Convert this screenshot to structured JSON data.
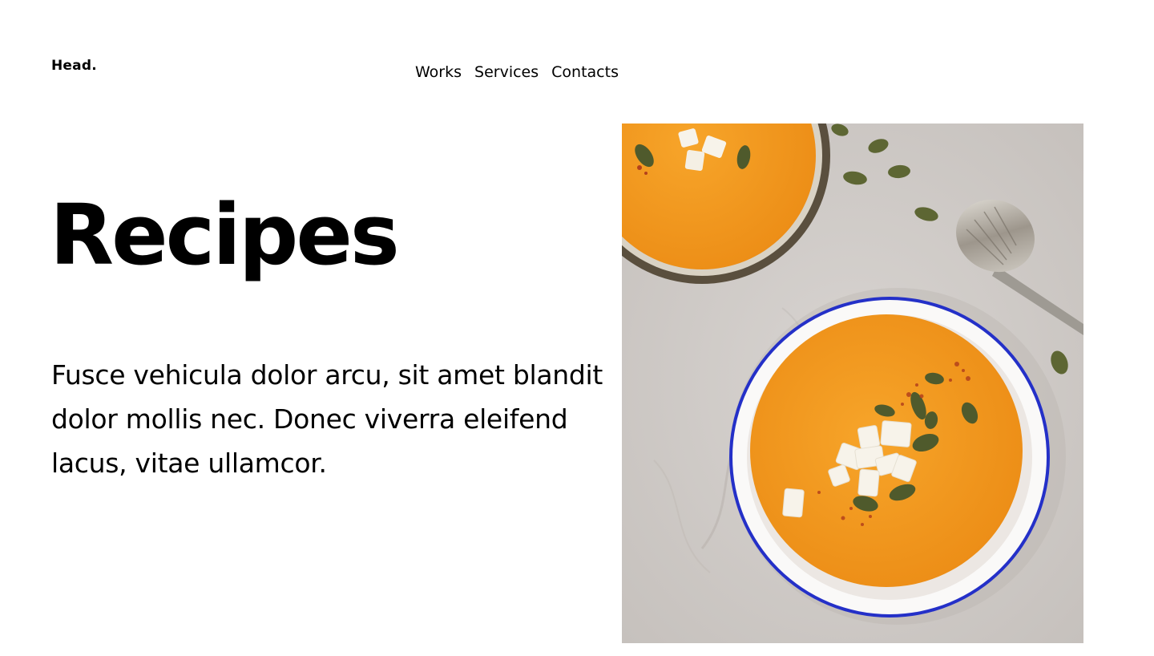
{
  "header": {
    "logo": "Head.",
    "nav": [
      {
        "label": "Works"
      },
      {
        "label": "Services"
      },
      {
        "label": "Contacts"
      }
    ]
  },
  "hero": {
    "title": "Recipes",
    "description": "Fusce vehicula dolor arcu, sit amet blandit dolor mollis nec. Donec viverra eleifend lacus, vitae ullamcor."
  },
  "image": {
    "subject": "soup-photo",
    "colors": {
      "table": "#cfcbc8",
      "soup": "#f29a1f",
      "bowl_rim": "#1f2ecc",
      "bowl_inner": "#f4f2f0",
      "dark_bowl": "#4e4535",
      "seeds": "#4f5a2c",
      "cheese": "#f7f3ea",
      "spoon": "#b7b3ab"
    }
  }
}
